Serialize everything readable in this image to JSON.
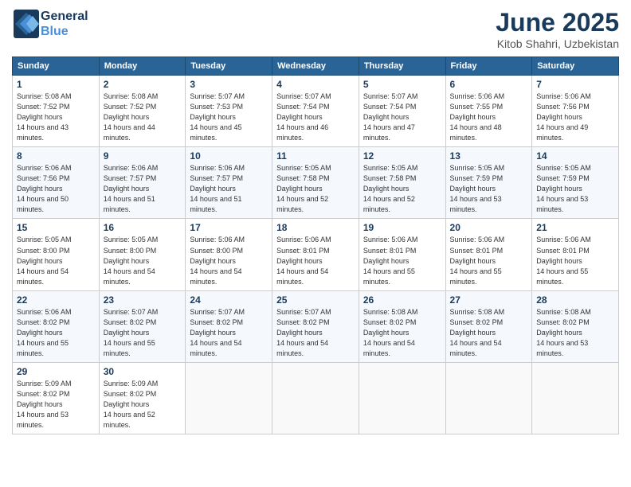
{
  "header": {
    "logo_line1": "General",
    "logo_line2": "Blue",
    "month_title": "June 2025",
    "location": "Kitob Shahri, Uzbekistan"
  },
  "days_of_week": [
    "Sunday",
    "Monday",
    "Tuesday",
    "Wednesday",
    "Thursday",
    "Friday",
    "Saturday"
  ],
  "weeks": [
    [
      {
        "day": 1,
        "sunrise": "5:08 AM",
        "sunset": "7:52 PM",
        "daylight": "14 hours and 43 minutes."
      },
      {
        "day": 2,
        "sunrise": "5:08 AM",
        "sunset": "7:52 PM",
        "daylight": "14 hours and 44 minutes."
      },
      {
        "day": 3,
        "sunrise": "5:07 AM",
        "sunset": "7:53 PM",
        "daylight": "14 hours and 45 minutes."
      },
      {
        "day": 4,
        "sunrise": "5:07 AM",
        "sunset": "7:54 PM",
        "daylight": "14 hours and 46 minutes."
      },
      {
        "day": 5,
        "sunrise": "5:07 AM",
        "sunset": "7:54 PM",
        "daylight": "14 hours and 47 minutes."
      },
      {
        "day": 6,
        "sunrise": "5:06 AM",
        "sunset": "7:55 PM",
        "daylight": "14 hours and 48 minutes."
      },
      {
        "day": 7,
        "sunrise": "5:06 AM",
        "sunset": "7:56 PM",
        "daylight": "14 hours and 49 minutes."
      }
    ],
    [
      {
        "day": 8,
        "sunrise": "5:06 AM",
        "sunset": "7:56 PM",
        "daylight": "14 hours and 50 minutes."
      },
      {
        "day": 9,
        "sunrise": "5:06 AM",
        "sunset": "7:57 PM",
        "daylight": "14 hours and 51 minutes."
      },
      {
        "day": 10,
        "sunrise": "5:06 AM",
        "sunset": "7:57 PM",
        "daylight": "14 hours and 51 minutes."
      },
      {
        "day": 11,
        "sunrise": "5:05 AM",
        "sunset": "7:58 PM",
        "daylight": "14 hours and 52 minutes."
      },
      {
        "day": 12,
        "sunrise": "5:05 AM",
        "sunset": "7:58 PM",
        "daylight": "14 hours and 52 minutes."
      },
      {
        "day": 13,
        "sunrise": "5:05 AM",
        "sunset": "7:59 PM",
        "daylight": "14 hours and 53 minutes."
      },
      {
        "day": 14,
        "sunrise": "5:05 AM",
        "sunset": "7:59 PM",
        "daylight": "14 hours and 53 minutes."
      }
    ],
    [
      {
        "day": 15,
        "sunrise": "5:05 AM",
        "sunset": "8:00 PM",
        "daylight": "14 hours and 54 minutes."
      },
      {
        "day": 16,
        "sunrise": "5:05 AM",
        "sunset": "8:00 PM",
        "daylight": "14 hours and 54 minutes."
      },
      {
        "day": 17,
        "sunrise": "5:06 AM",
        "sunset": "8:00 PM",
        "daylight": "14 hours and 54 minutes."
      },
      {
        "day": 18,
        "sunrise": "5:06 AM",
        "sunset": "8:01 PM",
        "daylight": "14 hours and 54 minutes."
      },
      {
        "day": 19,
        "sunrise": "5:06 AM",
        "sunset": "8:01 PM",
        "daylight": "14 hours and 55 minutes."
      },
      {
        "day": 20,
        "sunrise": "5:06 AM",
        "sunset": "8:01 PM",
        "daylight": "14 hours and 55 minutes."
      },
      {
        "day": 21,
        "sunrise": "5:06 AM",
        "sunset": "8:01 PM",
        "daylight": "14 hours and 55 minutes."
      }
    ],
    [
      {
        "day": 22,
        "sunrise": "5:06 AM",
        "sunset": "8:02 PM",
        "daylight": "14 hours and 55 minutes."
      },
      {
        "day": 23,
        "sunrise": "5:07 AM",
        "sunset": "8:02 PM",
        "daylight": "14 hours and 55 minutes."
      },
      {
        "day": 24,
        "sunrise": "5:07 AM",
        "sunset": "8:02 PM",
        "daylight": "14 hours and 54 minutes."
      },
      {
        "day": 25,
        "sunrise": "5:07 AM",
        "sunset": "8:02 PM",
        "daylight": "14 hours and 54 minutes."
      },
      {
        "day": 26,
        "sunrise": "5:08 AM",
        "sunset": "8:02 PM",
        "daylight": "14 hours and 54 minutes."
      },
      {
        "day": 27,
        "sunrise": "5:08 AM",
        "sunset": "8:02 PM",
        "daylight": "14 hours and 54 minutes."
      },
      {
        "day": 28,
        "sunrise": "5:08 AM",
        "sunset": "8:02 PM",
        "daylight": "14 hours and 53 minutes."
      }
    ],
    [
      {
        "day": 29,
        "sunrise": "5:09 AM",
        "sunset": "8:02 PM",
        "daylight": "14 hours and 53 minutes."
      },
      {
        "day": 30,
        "sunrise": "5:09 AM",
        "sunset": "8:02 PM",
        "daylight": "14 hours and 52 minutes."
      },
      null,
      null,
      null,
      null,
      null
    ]
  ],
  "labels": {
    "sunrise": "Sunrise:",
    "sunset": "Sunset:",
    "daylight": "Daylight hours"
  }
}
